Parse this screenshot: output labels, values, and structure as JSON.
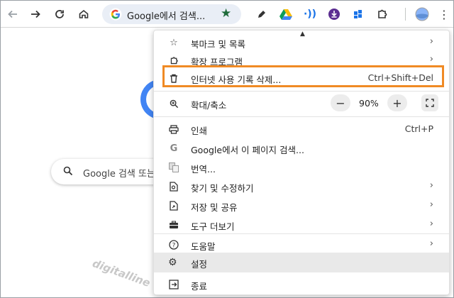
{
  "omnibox": {
    "text": "Google에서 검색..."
  },
  "page": {
    "search_placeholder": "Google 검색 또는"
  },
  "watermark": "digitalline",
  "menu": {
    "bookmarks": "북마크 및 목록",
    "extensions": "확장 프로그램",
    "clear_history": "인터넷 사용 기록 삭제...",
    "clear_history_shortcut": "Ctrl+Shift+Del",
    "zoom": "확대/축소",
    "zoom_value": "90%",
    "print": "인쇄",
    "print_shortcut": "Ctrl+P",
    "search_page": "Google에서 이 페이지 검색...",
    "translate": "번역...",
    "find_edit": "찾기 및 수정하기",
    "save_share": "저장 및 공유",
    "more_tools": "도구 더보기",
    "help": "도움말",
    "settings": "설정",
    "exit": "종료"
  },
  "colors": {
    "highlight": "#f08a24",
    "accent": "#4285f4"
  }
}
